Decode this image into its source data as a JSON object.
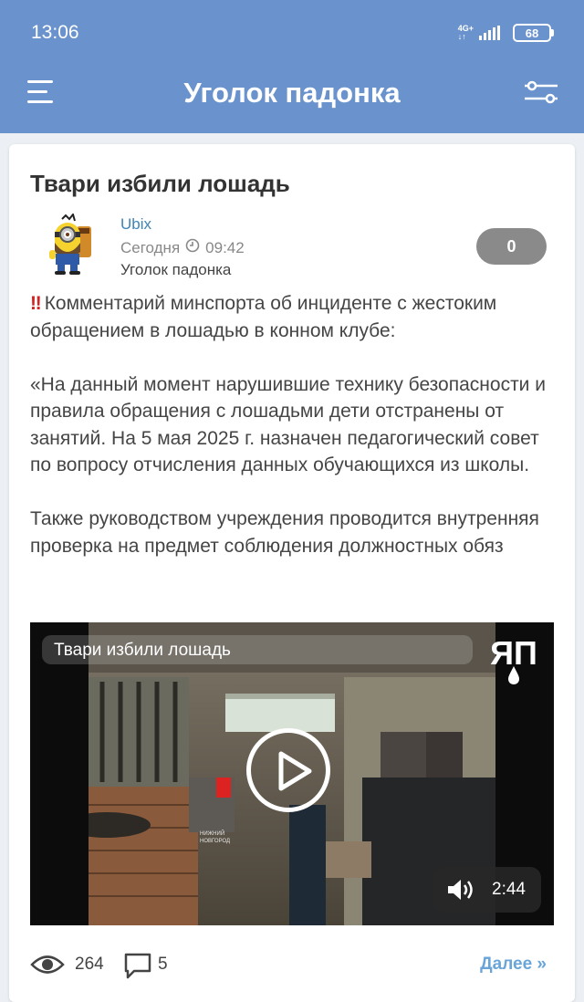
{
  "status_bar": {
    "time": "13:06",
    "network_top": "4G+",
    "network_bottom": "↓↑",
    "battery": "68"
  },
  "header": {
    "title": "Уголок падонка",
    "menu_icon": "hamburger-menu-icon",
    "filter_icon": "filter-sliders-icon"
  },
  "post": {
    "title": "Твари избили лошадь",
    "author": "Ubix",
    "date": "Сегодня",
    "time": "09:42",
    "community": "Уголок падонка",
    "rating": "0",
    "paragraphs": [
      "Комментарий минспорта об инциденте с жестоким обращением в лошадью в конном клубе:",
      "«На данный момент нарушившие технику безопасности и правила обращения с лошадьми дети отстранены от занятий. На 5 мая 2025 г. назначен педагогический совет по вопросу отчисления данных обучающихся из школы.",
      "Также руководством учреждения проводится внутренняя проверка на предмет соблюдения должностных обяз"
    ],
    "alert_emoji": "‼",
    "video": {
      "title": "Твари избили лошадь",
      "duration": "2:44",
      "logo_text": "ЯП",
      "watermark_line1": "НИЖНИЙ",
      "watermark_line2": "НОВГОРОД"
    },
    "stats": {
      "views": "264",
      "comments": "5",
      "more_label": "Далее »"
    }
  },
  "colors": {
    "header": "#6a93cd",
    "author": "#3f84b8",
    "link": "#69a5d8",
    "alert": "#d32222",
    "rating_bg": "#8a8a8a"
  }
}
